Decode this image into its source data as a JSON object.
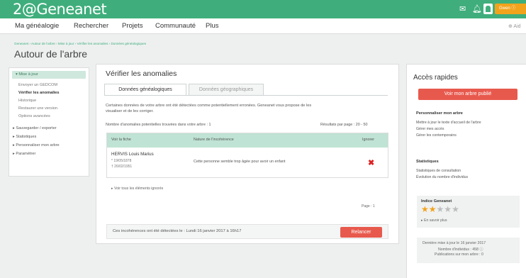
{
  "header": {
    "logo": "2@Geneanet",
    "user_button": "Gwen ⓘ",
    "mail_icon": "mail-icon",
    "bell_icon": "bell-icon",
    "avatar_icon": "avatar-icon"
  },
  "menu": {
    "items": [
      "Ma généalogie",
      "Rechercher",
      "Projets",
      "Communauté",
      "Plus"
    ],
    "help": "⊕ Aid"
  },
  "breadcrumb": "Geneanet › Autour de l'arbre › Mise à jour › Vérifier les anomalies › Données généalogiques",
  "page_title": "Autour de l'arbre",
  "sidebar": {
    "section_open": "▾ Mise à jour",
    "sub_items": [
      "Envoyer un GEDCOM",
      "Vérifier les anomalies",
      "Historique",
      "Restaurer une version",
      "Options avancées"
    ],
    "sections": [
      "▸ Sauvegarder / exporter",
      "▸ Statistiques",
      "▸ Personnaliser mon arbre",
      "▸ Paramétrer"
    ]
  },
  "main": {
    "title": "Vérifier les anomalies",
    "tabs": [
      "Données généalogiques",
      "Données géographiques"
    ],
    "description_line1": "Certaines données de votre arbre ont été détectées comme potentiellement erronées. Geneanet vous propose de les",
    "description_line2": "visualiser et de les corriger.",
    "count_label": "Nombre d'anomalies potentielles trouvées dans votre arbre : 1",
    "results_per_page": "Résultats par page : 20 - 50",
    "table": {
      "col_fiche": "Voir la fiche",
      "col_nature": "Nature de l'incohérence",
      "col_ignorer": "Ignorer",
      "row": {
        "name": "HERVIS Louis Marius",
        "birth": "* 19/05/1878",
        "death": "† 26/02/1951",
        "nature": "Cette personne semble trop âgée pour avoir un enfant"
      }
    },
    "view_ignored": "▸ Voir tous les éléments ignorés",
    "page_label": "Page : 1",
    "detected_text": "Ces incohérences ont été détectées le : Lundi 16 janvier 2017 à 16h17",
    "relaunch_button": "Relancer"
  },
  "right": {
    "title": "Accès rapides",
    "publish_button": "Voir mon arbre publié",
    "personalize_title": "Personnaliser mon arbre",
    "personalize_links": [
      "Mettre à jour le texte d'accueil de l'arbre",
      "Gérer mes accès",
      "Gérer les contemporains"
    ],
    "stats_title": "Statistiques",
    "stats_links": [
      "Statistiques de consultation",
      "Évolution du nombre d'individus"
    ],
    "index_title": "Indice Geneanet",
    "stars_filled": 2,
    "stars_total": 5,
    "stars_text": "★★★★★",
    "learn_more": "▸ En savoir plus",
    "update_line1": "Dernière mise à jour le 16 janvier 2017",
    "update_line2": "Nombre d'individus : 458 ⓘ",
    "update_line3": "Publications sur mon arbre : 0"
  },
  "colors": {
    "brand_green": "#3fae7c",
    "accent_red": "#e8594d",
    "user_orange": "#f2a31c",
    "table_header": "#bfe3d4"
  }
}
